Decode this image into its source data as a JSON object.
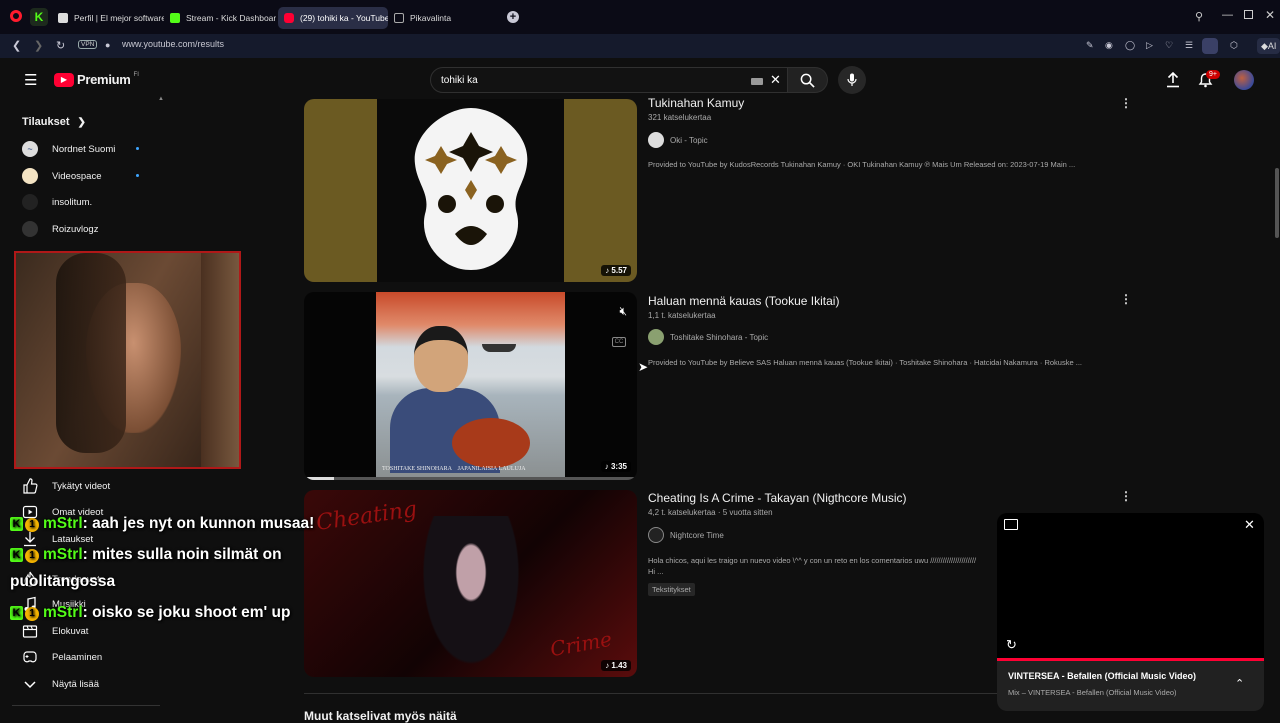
{
  "browser": {
    "tabs": [
      {
        "label": "Perfil | El mejor software p",
        "active": false
      },
      {
        "label": "Stream - Kick Dashboard",
        "active": false
      },
      {
        "label": "(29) tohiki ka - YouTube",
        "active": true
      },
      {
        "label": "Pikavalinta",
        "active": false
      }
    ],
    "url": "www.youtube.com/results",
    "vpn_label": "VPN",
    "ai_label": "AI"
  },
  "header": {
    "logo_text": "Premium",
    "logo_region": "FI",
    "search_value": "tohiki ka",
    "notification_count": "9+"
  },
  "sidebar": {
    "subscriptions_title": "Tilaukset",
    "subscriptions": [
      {
        "label": "Nordnet Suomi",
        "new": true
      },
      {
        "label": "Videospace",
        "new": true
      },
      {
        "label": "insolitum.",
        "new": false
      },
      {
        "label": "Roizuvlogz",
        "new": false
      }
    ],
    "items": [
      {
        "label": "Tykätyt videot",
        "icon": "thumbs-up-icon"
      },
      {
        "label": "Omat videot",
        "icon": "play-square-icon"
      },
      {
        "label": "Lataukset",
        "icon": "download-icon"
      },
      {
        "label": "Trendaavat",
        "icon": "fire-icon"
      },
      {
        "label": "Musiikki",
        "icon": "music-icon"
      },
      {
        "label": "Elokuvat",
        "icon": "film-icon"
      },
      {
        "label": "Pelaaminen",
        "icon": "gamepad-icon"
      },
      {
        "label": "Näytä lisää",
        "icon": "chevron-down-icon"
      }
    ]
  },
  "results": [
    {
      "title": "Tukinahan Kamuy",
      "meta": "321 katselukertaa",
      "channel": "Oki - Topic",
      "description": "Provided to YouTube by KudosRecords Tukinahan Kamuy · OKI Tukinahan Kamuy ℗ Mais Um Released on: 2023-07-19 Main ...",
      "duration": "5.57"
    },
    {
      "title": "Haluan mennä kauas (Tookue Ikitai)",
      "meta": "1,1 t. katselukertaa",
      "channel": "Toshitake Shinohara - Topic",
      "description": "Provided to YouTube by Believe SAS Haluan mennä kauas (Tookue Ikitai) · Toshitake Shinohara · Hatcidai Nakamura · Rokuske ...",
      "duration": "3:35",
      "album_text": "TOSHITAKE SHINOHARA    JAPANILAISIA LAULUJA"
    },
    {
      "title": "Cheating Is A Crime - Takayan (Nigthcore Music)",
      "meta": "4,2 t. katselukertaa · 5 vuotta sitten",
      "channel": "Nightcore Time",
      "description": "Hola chicos, aqui les traigo un nuevo video \\^^ y con un reto en los comentarios uwu //////////////////////",
      "description2": "Hi ...",
      "tag": "Tekstitykset",
      "duration": "1.43"
    }
  ],
  "section_heading": "Muut katselivat myös näitä",
  "chat": [
    {
      "user": "mStrl",
      "message": ": aah jes nyt on kunnon musaa!"
    },
    {
      "user": "mStrl",
      "message": ": mites sulla noin silmät on"
    },
    {
      "user": "",
      "message": "puolitangossa"
    },
    {
      "user": "mStrl",
      "message": ": oisko se joku shoot em' up"
    }
  ],
  "miniplayer": {
    "title": "VINTERSEA - Befallen (Official Music Video)",
    "subtitle": "Mix – VINTERSEA - Befallen (Official Music Video)"
  },
  "colors": {
    "accent": "#ff0033",
    "kick_green": "#53fc18",
    "background": "#0f0f0f"
  }
}
